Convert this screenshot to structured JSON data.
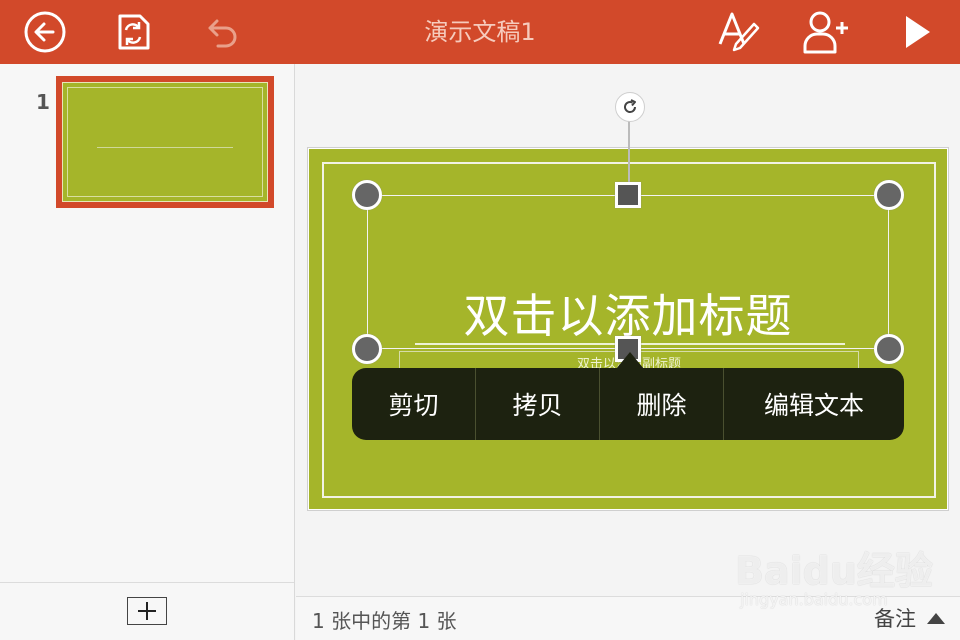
{
  "app": {
    "title": "演示文稿1",
    "accent": "#d2492a",
    "slide_color": "#a5b52a"
  },
  "toolbar": {
    "icons": [
      "back-arrow-icon",
      "file-sync-icon",
      "undo-icon",
      "format-text-icon",
      "add-person-icon",
      "play-icon"
    ]
  },
  "thumbnails": [
    {
      "number": "1"
    }
  ],
  "slide": {
    "title_placeholder": "双击以添加标题",
    "subtitle_placeholder": "双击以添加副标题"
  },
  "context_menu": {
    "items": [
      "剪切",
      "拷贝",
      "删除",
      "编辑文本"
    ]
  },
  "status": {
    "slide_count": "1 张中的第 1 张",
    "notes_label": "备注"
  },
  "watermark": {
    "brand": "Baidu经验",
    "url": "jingyan.baidu.com"
  }
}
